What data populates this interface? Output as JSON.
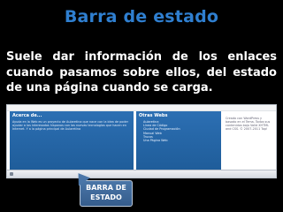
{
  "slide": {
    "title": "Barra de estado",
    "description": "Suele dar información de los enlaces cuando pasamos sobre ellos, del estado de una página cuando se carga."
  },
  "screenshot": {
    "left_panel": {
      "heading": "Acerca de...",
      "text": "Ayuda en la Web es un proyecto de Aularetina que nace con la idea de poder ayudar a los interesados hispanos con las nuevas tecnologías que hacen en Internet. Y a la página principal de Aularetina"
    },
    "middle_panel": {
      "heading": "Otras Webs",
      "items": [
        "Aularetina",
        "Línea de Código",
        "Ciudad de Programación",
        "Manual Web",
        "Trucos",
        "Una Página Web"
      ]
    },
    "right_panel": {
      "text": "Creado con WordPress y basado en el Tema. Todos sus contenidos bajo Valid XHTML and CSS. © 2007-2011 Top!"
    },
    "status_bar": {
      "text": ""
    }
  },
  "callout": {
    "line1": "BARRA DE",
    "line2": "ESTADO"
  },
  "colors": {
    "title": "#2f7fd0",
    "background": "#000000",
    "panel": "#2c6fb3",
    "callout": "#4a76a8"
  }
}
